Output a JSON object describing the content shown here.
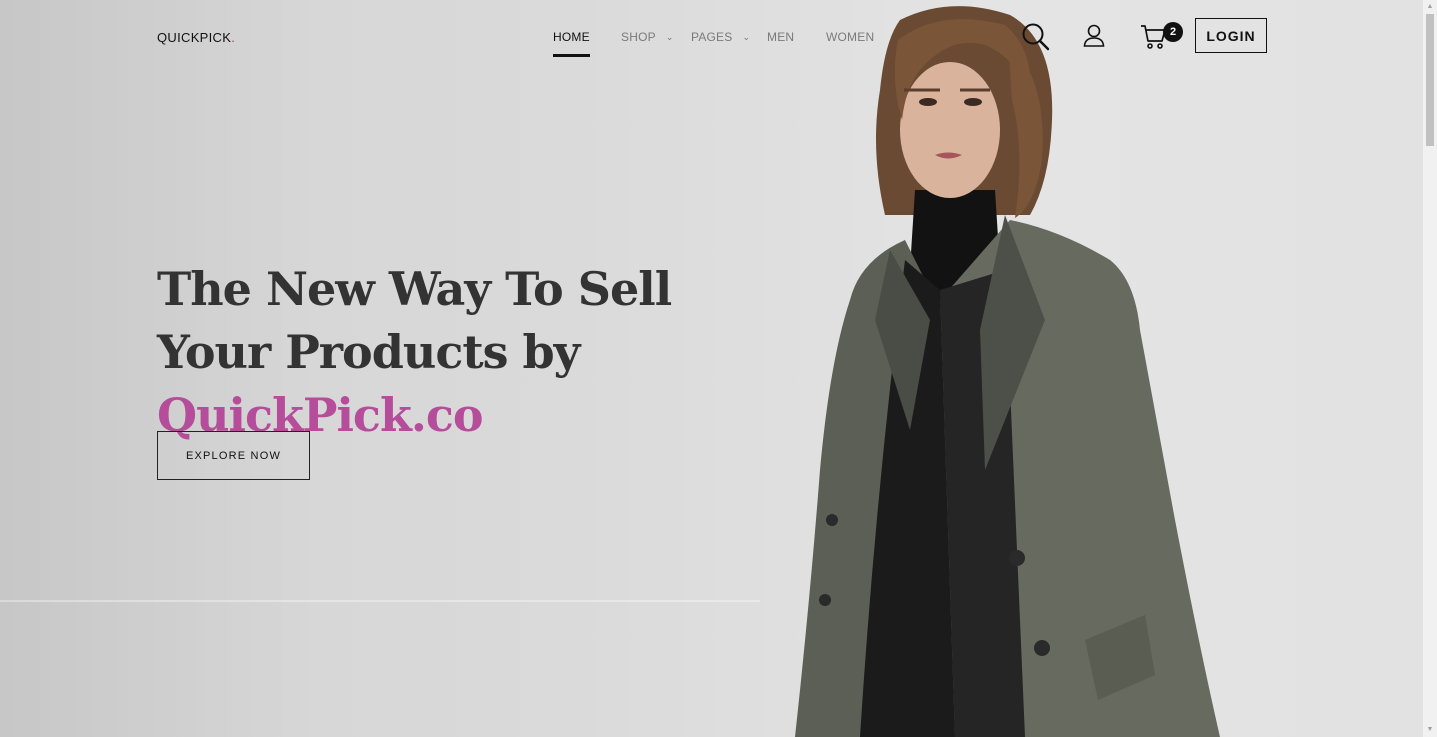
{
  "header": {
    "logo_text": "QUICKPICK",
    "logo_dot": ".",
    "nav": [
      {
        "label": "HOME",
        "active": true
      },
      {
        "label": "SHOP",
        "has_dropdown": true
      },
      {
        "label": "PAGES",
        "has_dropdown": true
      },
      {
        "label": "MEN"
      },
      {
        "label": "WOMEN"
      }
    ],
    "icons": [
      "search-icon",
      "user-icon",
      "cart-icon"
    ],
    "cart_count": "2",
    "login_label": "LOGIN"
  },
  "hero": {
    "headline_part1": "The New Way To Sell Your Products by ",
    "headline_accent": "QuickPick.co",
    "cta_label": "EXPLORE NOW"
  },
  "colors": {
    "accent": "#b54d9a",
    "logo_dot": "#c0392b",
    "text_dark": "#333333"
  }
}
